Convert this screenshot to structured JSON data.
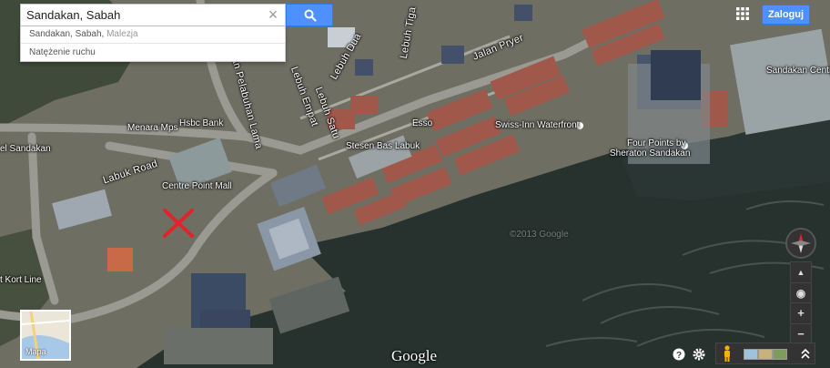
{
  "search": {
    "value": "Sandakan, Sabah",
    "placeholder": "",
    "clear_icon": "close-icon",
    "button_icon": "search-icon"
  },
  "suggestions": [
    {
      "main": "Sandakan, Sabah,",
      "secondary": "Malezja"
    },
    {
      "main": "Natężenie ruchu",
      "secondary": ""
    }
  ],
  "header": {
    "apps_icon": "apps-grid-icon",
    "login_label": "Zaloguj"
  },
  "map_labels": {
    "streets": {
      "lebuh_dua": "Lebuh Dua",
      "lebuh_tiga": "Lebuh Tiga",
      "jalan_pryer": "Jalan Pryer",
      "jalan_pelabuhan": "Jalan Pelabuhan Lama",
      "lebuh_empat": "Lebuh Empat",
      "lebuh_satu": "Lebuh Satu",
      "labuk_road": "Labuk Road"
    },
    "places": {
      "menara_mps": "Menara Mps",
      "hsbc": "Hsbc Bank",
      "esso": "Esso",
      "swiss_inn": "Swiss-Inn Waterfront",
      "stesen_bas": "Stesen Bas Labuk",
      "four_points_1": "Four Points by",
      "four_points_2": "Sheraton Sandakan",
      "centre_point": "Centre Point Mall",
      "sandakan_left": "el Sandakan",
      "sandakan_central": "Sandakan Central",
      "kort_line": "t Kort Line",
      "watermark": "©2013 Google"
    }
  },
  "minimap": {
    "label": "Mapa"
  },
  "footer": {
    "logo": "Google",
    "help_icon": "help-icon",
    "settings_icon": "gear-icon"
  },
  "controls": {
    "compass_icon": "compass-icon",
    "tilt_icon": "tilt-icon",
    "location_icon": "my-location-icon",
    "zoom_in": "+",
    "zoom_out": "−",
    "pegman_icon": "pegman-icon",
    "expand_icon": "chevron-up-icon"
  },
  "colors": {
    "accent_blue": "#4d90fe",
    "marker_red": "#e0242a",
    "water": "#26312e",
    "land": "#7a7a6e"
  }
}
